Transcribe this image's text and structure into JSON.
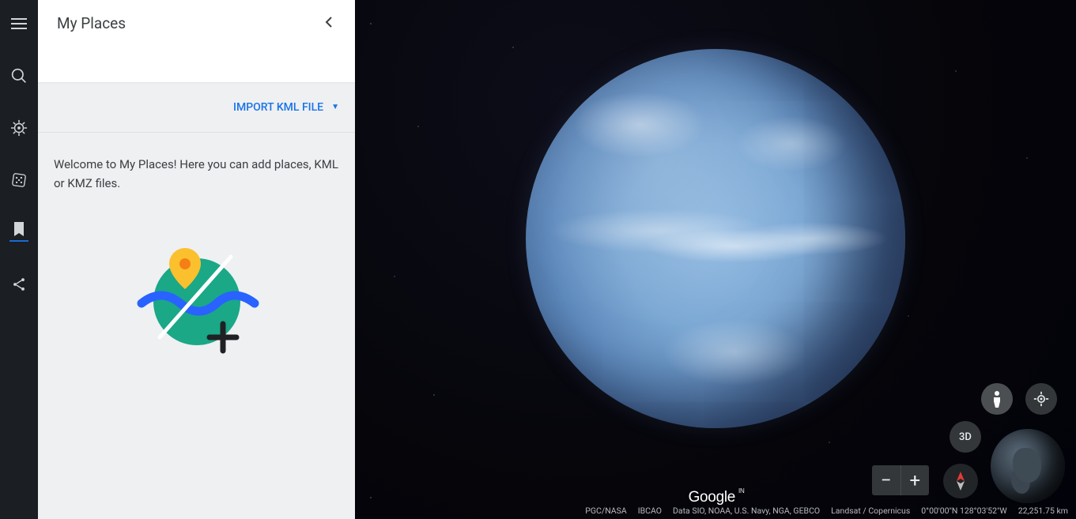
{
  "rail": {
    "menu": "menu",
    "search": "search",
    "voyager": "voyager",
    "lucky": "lucky",
    "places": "places",
    "share": "share"
  },
  "panel": {
    "title": "My Places",
    "import_label": "IMPORT KML FILE",
    "welcome_text": "Welcome to My Places! Here you can add places, KML or KMZ files."
  },
  "map": {
    "logo": "Google",
    "logo_sup": "IN",
    "threeD_label": "3D",
    "attribution_source": "PGC/NASA",
    "attribution_bathy": "IBCAO",
    "attribution_data": "Data SIO, NOAA, U.S. Navy, NGA, GEBCO",
    "attribution_imagery": "Landsat / Copernicus",
    "coords": "0°00'00\"N 128°03'52\"W",
    "eye_alt": "22,251.75 km"
  }
}
